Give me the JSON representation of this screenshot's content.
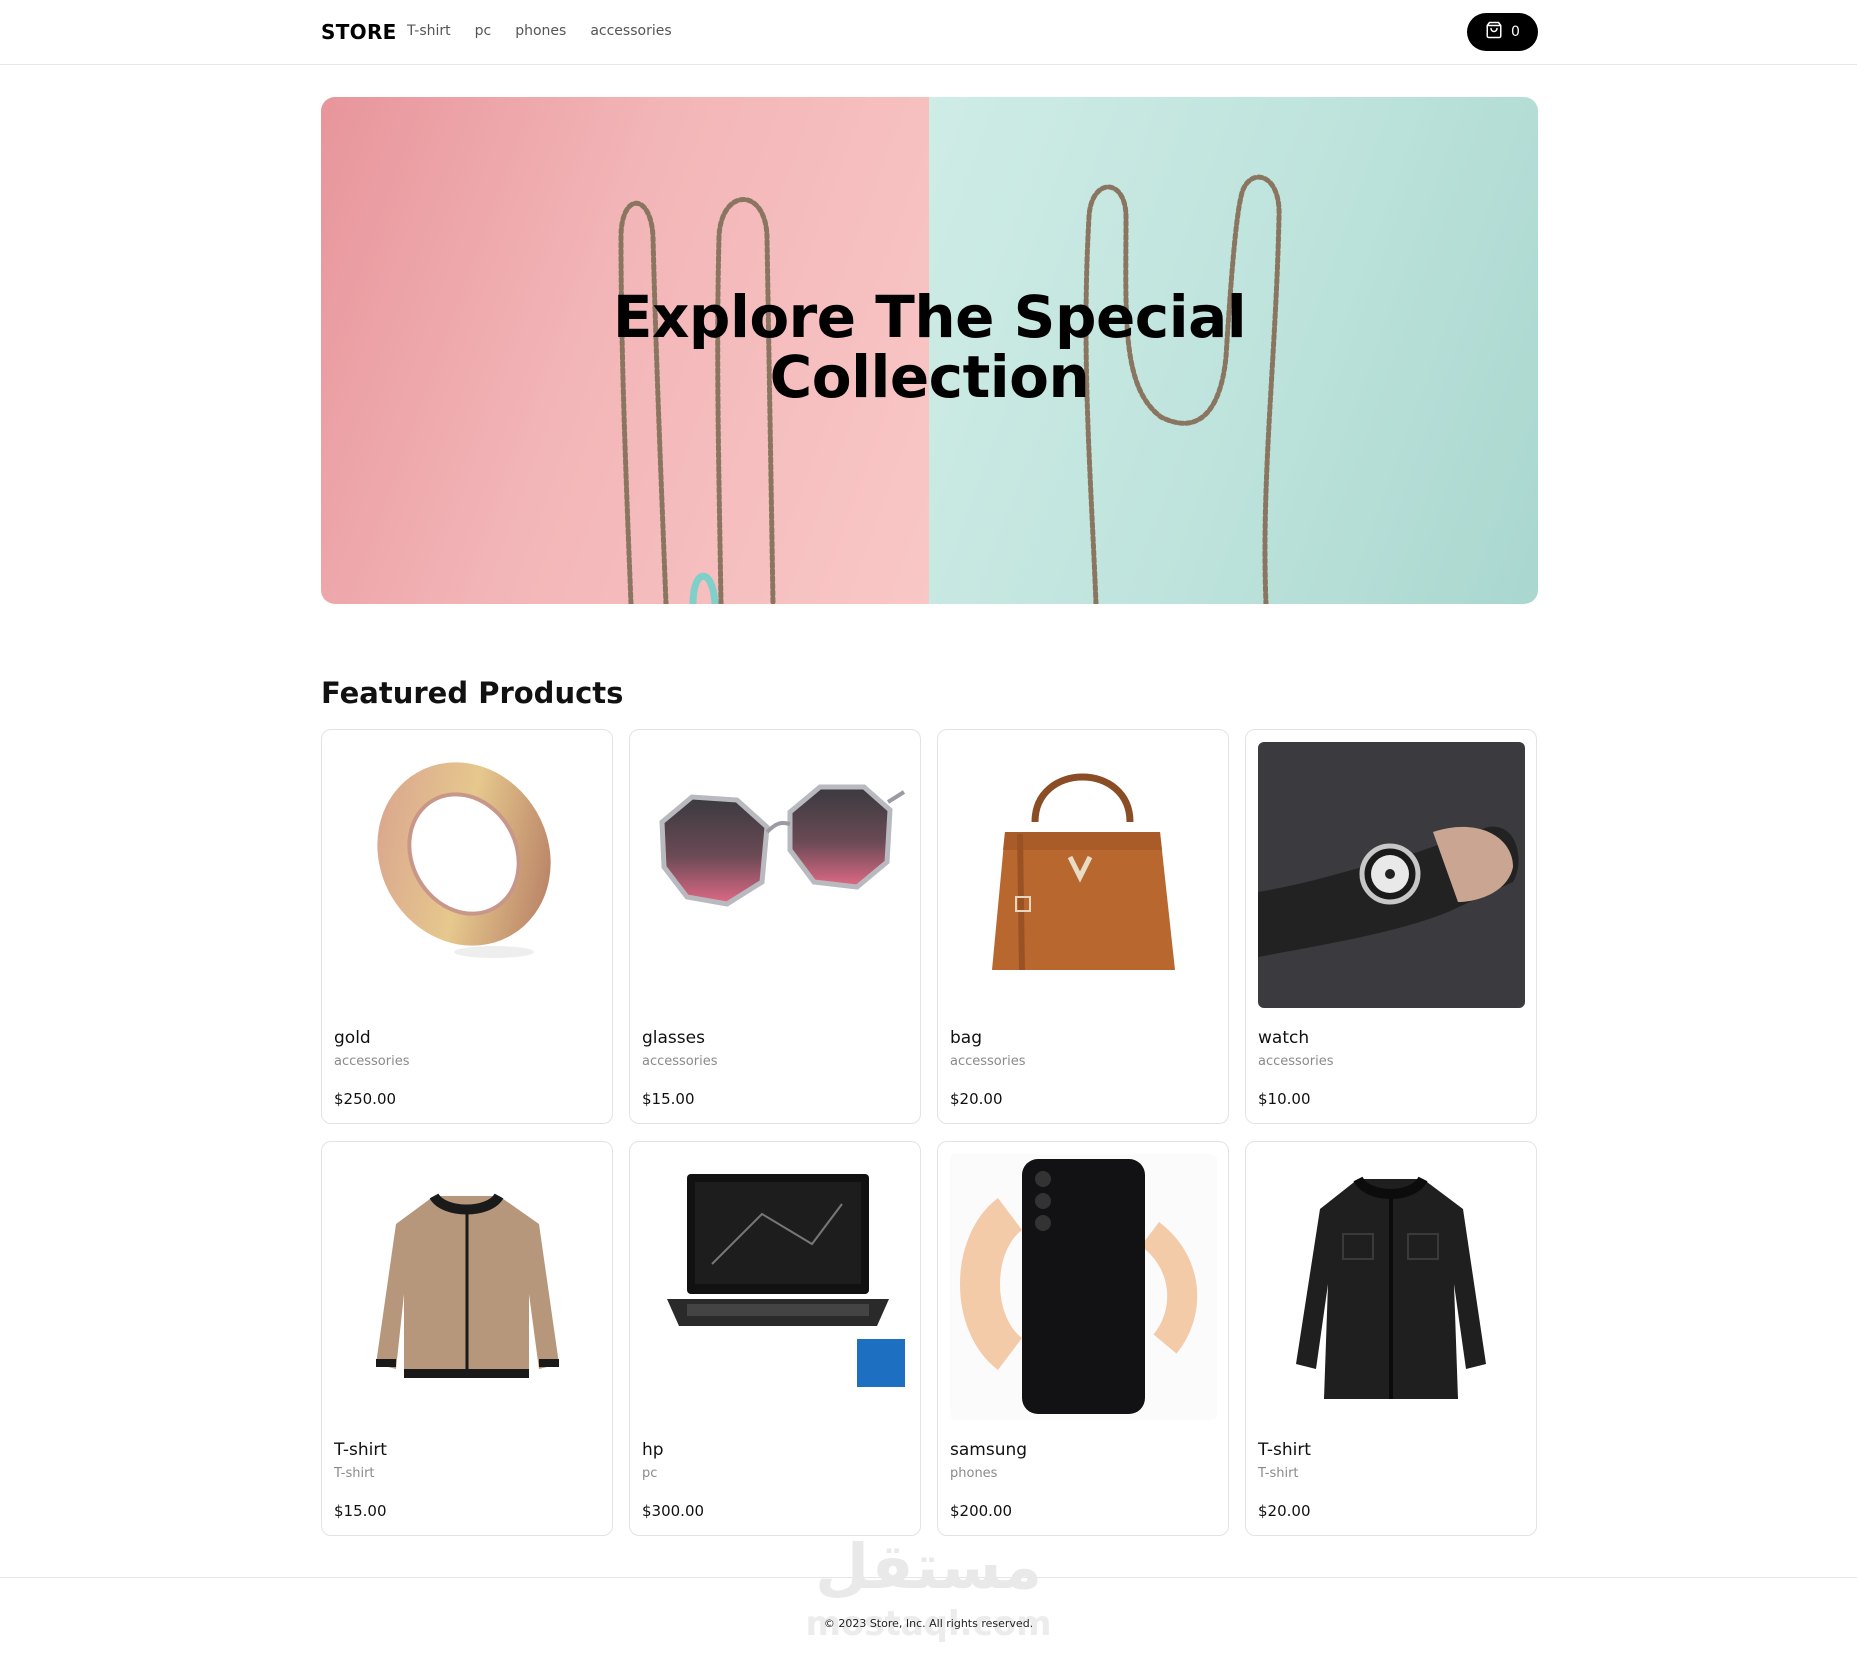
{
  "header": {
    "brand": "STORE",
    "nav": [
      "T-shirt",
      "pc",
      "phones",
      "accessories"
    ],
    "cart_count": "0"
  },
  "hero": {
    "title_line1": "Explore The Special",
    "title_line2": "Collection"
  },
  "featured": {
    "title": "Featured Products",
    "products": [
      {
        "name": "gold",
        "category": "accessories",
        "price": "$250.00",
        "icon": "ring-image"
      },
      {
        "name": "glasses",
        "category": "accessories",
        "price": "$15.00",
        "icon": "sunglasses-image"
      },
      {
        "name": "bag",
        "category": "accessories",
        "price": "$20.00",
        "icon": "handbag-image"
      },
      {
        "name": "watch",
        "category": "accessories",
        "price": "$10.00",
        "icon": "watch-image"
      },
      {
        "name": "T-shirt",
        "category": "T-shirt",
        "price": "$15.00",
        "icon": "beige-jacket-image"
      },
      {
        "name": "hp",
        "category": "pc",
        "price": "$300.00",
        "icon": "laptop-image"
      },
      {
        "name": "samsung",
        "category": "phones",
        "price": "$200.00",
        "icon": "phone-image"
      },
      {
        "name": "T-shirt",
        "category": "T-shirt",
        "price": "$20.00",
        "icon": "black-jacket-image"
      }
    ]
  },
  "footer": {
    "copyright": "© 2023 Store, Inc. All rights reserved.",
    "watermark": "مستقل",
    "watermark_sub": "mostaql.com"
  },
  "colors": {
    "hero_pink": "#f3b6b8",
    "hero_mint": "#bfe4dd",
    "cart_button": "#000000"
  }
}
